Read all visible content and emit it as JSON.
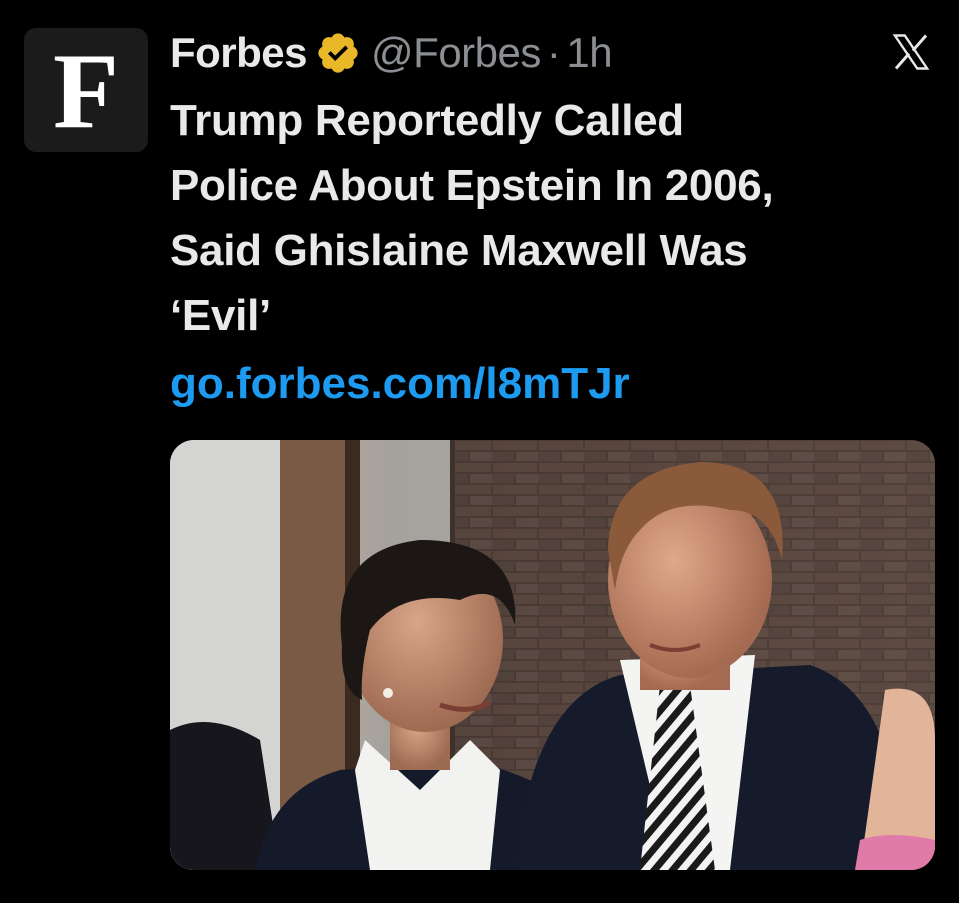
{
  "post": {
    "author_name": "Forbes",
    "avatar_letter": "F",
    "handle": "@Forbes",
    "separator": "·",
    "time": "1h",
    "headline_lines": [
      "Trump Reportedly Called",
      "Police About Epstein In 2006,",
      "Said Ghislaine Maxwell Was",
      "‘Evil’"
    ],
    "link_text": "go.forbes.com/l8mTJr"
  },
  "icons": {
    "verified": "verified-badge-icon",
    "platform": "x-logo-icon"
  },
  "colors": {
    "background": "#000000",
    "text_primary": "#e7e9ea",
    "text_secondary": "#8b8f93",
    "link": "#1d9bf0",
    "verified_gold": "#e8b829"
  }
}
